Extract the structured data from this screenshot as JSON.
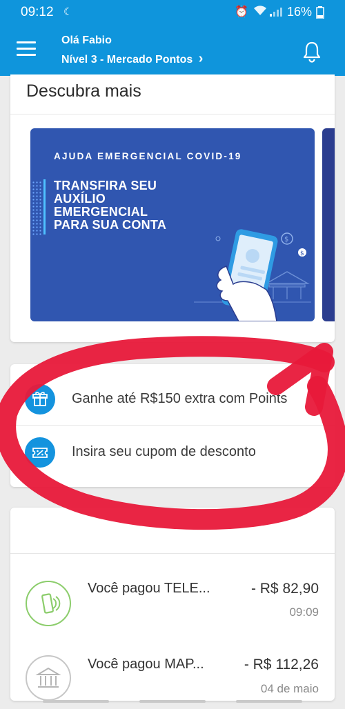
{
  "status_bar": {
    "time": "09:12",
    "battery": "16%"
  },
  "header": {
    "greeting": "Olá Fabio",
    "level": "Nível 3 - Mercado Pontos",
    "chevron": "›"
  },
  "discover": {
    "title": "Descubra mais",
    "banner": {
      "tag": "AJUDA EMERGENCIAL COVID-19",
      "lines": [
        "TRANSFIRA SEU",
        "AUXÍLIO",
        "EMERGENCIAL",
        "PARA SUA CONTA"
      ]
    }
  },
  "actions": [
    {
      "label": "Ganhe até R$150 extra com Points",
      "icon": "gift-icon"
    },
    {
      "label": "Insira seu cupom de desconto",
      "icon": "coupon-icon"
    }
  ],
  "transactions": [
    {
      "title": "Você pagou TELE...",
      "amount": "- R$ 82,90",
      "meta": "09:09",
      "icon": "phone-icon"
    },
    {
      "title": "Você pagou MAP...",
      "amount": "- R$ 112,26",
      "meta": "04 de maio",
      "icon": "bank-icon"
    }
  ],
  "colors": {
    "primary": "#0f95dc",
    "banner": "#3056b0",
    "annotation": "#e8193a"
  }
}
